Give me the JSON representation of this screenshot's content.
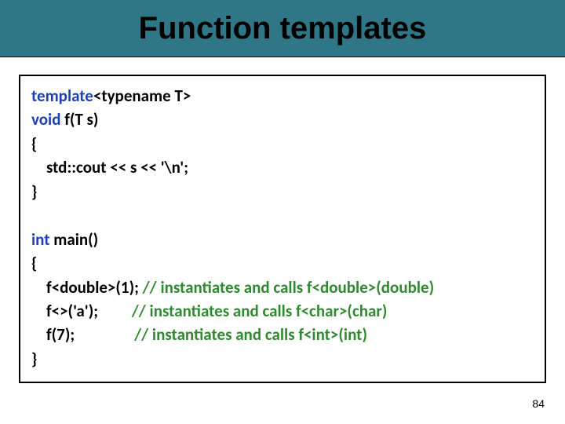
{
  "title": "Function templates",
  "code": {
    "l1_kw": "template",
    "l1_rest": "<typename T>",
    "l2_kw": "void",
    "l2_rest": " f(T s)",
    "l3": "{",
    "l4": "    std::cout << s << '\\n';",
    "l5": "}",
    "blank1": " ",
    "l6_kw": "int",
    "l6_rest": " main()",
    "l7": "{",
    "l8_code": "    f<double>(1); ",
    "l8_cm": "// instantiates and calls f<double>(double)",
    "l9_code": "    f<>('a');         ",
    "l9_cm": "// instantiates and calls f<char>(char)",
    "l10_code": "    f(7);                ",
    "l10_cm": "// instantiates and calls f<int>(int)",
    "l11": "}"
  },
  "page_number": "84"
}
